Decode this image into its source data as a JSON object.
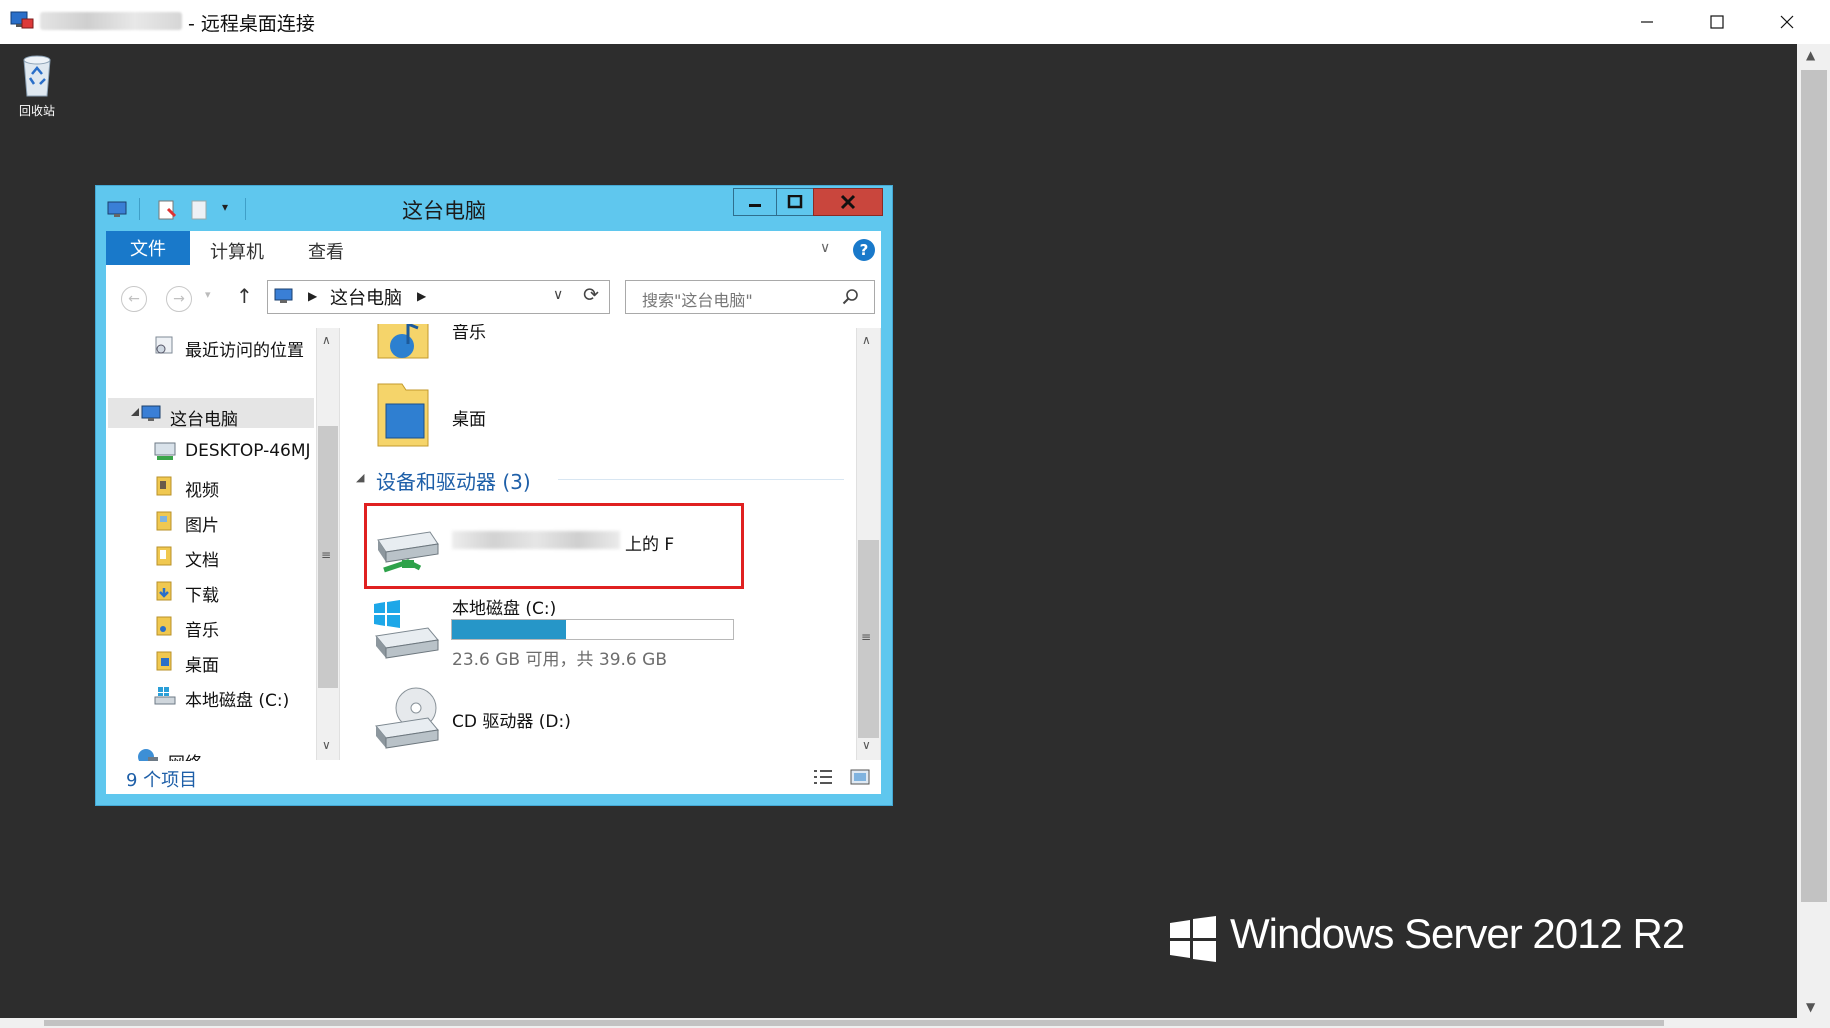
{
  "rdp_window": {
    "title": "- 远程桌面连接",
    "controls": {
      "minimize": "—",
      "maximize": "☐",
      "close": "✕"
    }
  },
  "desktop": {
    "recycle_bin_label": "回收站",
    "os_brand": "Windows Server 2012 R2",
    "background_color": "#2d2d2d"
  },
  "explorer": {
    "title": "这台电脑",
    "accent_color": "#5fc7ee",
    "ribbon_tabs": [
      {
        "label": "文件",
        "active": true
      },
      {
        "label": "计算机",
        "active": false
      },
      {
        "label": "查看",
        "active": false
      }
    ],
    "ribbon_help": "?",
    "navigation": {
      "back": "←",
      "forward": "→",
      "up": "↑",
      "address_path": "这台电脑",
      "refresh": "⟳",
      "search_placeholder": "搜索\"这台电脑\""
    },
    "nav_pane": {
      "items": [
        {
          "label": "最近访问的位置",
          "icon": "recent-places-icon"
        },
        {
          "label": "这台电脑",
          "icon": "this-pc-icon",
          "selected": true
        },
        {
          "label": "DESKTOP-46MJ",
          "icon": "network-computer-icon"
        },
        {
          "label": "视频",
          "icon": "videos-folder-icon"
        },
        {
          "label": "图片",
          "icon": "pictures-folder-icon"
        },
        {
          "label": "文档",
          "icon": "documents-folder-icon"
        },
        {
          "label": "下载",
          "icon": "downloads-folder-icon"
        },
        {
          "label": "音乐",
          "icon": "music-folder-icon"
        },
        {
          "label": "桌面",
          "icon": "desktop-folder-icon"
        },
        {
          "label": "本地磁盘 (C:)",
          "icon": "local-disk-icon"
        },
        {
          "label": "网络",
          "icon": "network-icon"
        }
      ]
    },
    "content": {
      "folders": [
        {
          "label": "音乐",
          "icon": "music-folder-icon"
        },
        {
          "label": "桌面",
          "icon": "desktop-folder-icon"
        }
      ],
      "group_header": "设备和驱动器 (3)",
      "drives": [
        {
          "label_suffix": "上的 F",
          "icon": "network-drive-icon",
          "highlighted": true
        },
        {
          "label": "本地磁盘 (C:)",
          "icon": "windows-drive-icon",
          "free_text": "23.6 GB 可用，共 39.6 GB",
          "used_fraction": 0.404
        },
        {
          "label": "CD 驱动器 (D:)",
          "icon": "cd-drive-icon"
        }
      ]
    },
    "status_text": "9 个项目"
  }
}
